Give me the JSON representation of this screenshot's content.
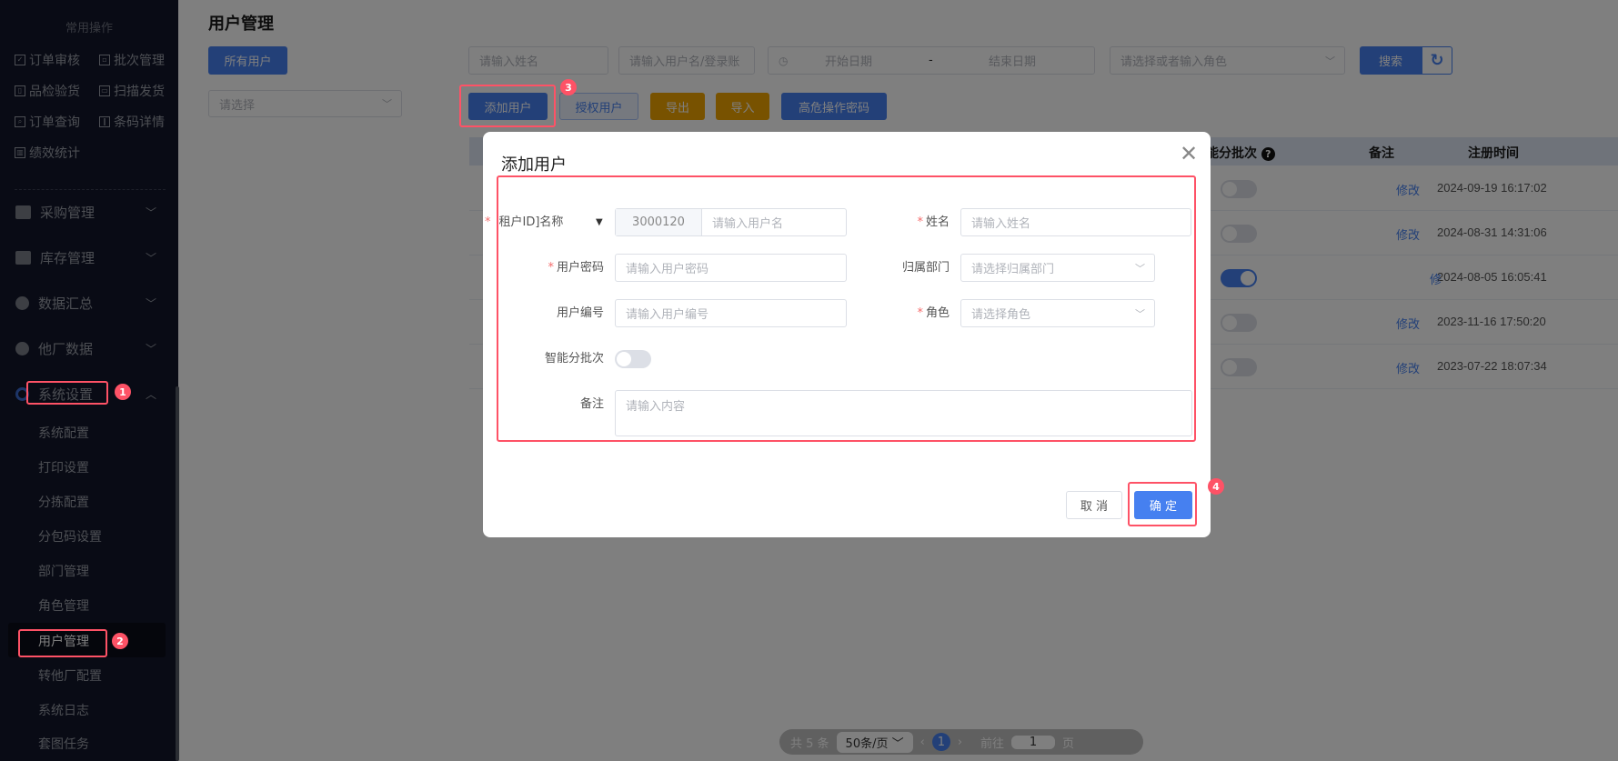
{
  "sidebar": {
    "quick_title": "常用操作",
    "quick_items": [
      {
        "label": "订单审核",
        "icon": "check-box-icon"
      },
      {
        "label": "批次管理",
        "icon": "batch-icon"
      },
      {
        "label": "品检验货",
        "icon": "inspect-icon"
      },
      {
        "label": "扫描发货",
        "icon": "scan-icon"
      },
      {
        "label": "订单查询",
        "icon": "search-order-icon"
      },
      {
        "label": "条码详情",
        "icon": "barcode-icon"
      },
      {
        "label": "绩效统计",
        "icon": "chart-icon"
      }
    ],
    "menus": [
      {
        "label": "采购管理",
        "icon": "store-icon",
        "chevron": "﹀"
      },
      {
        "label": "库存管理",
        "icon": "inventory-icon",
        "chevron": "﹀"
      },
      {
        "label": "数据汇总",
        "icon": "pie-chart-icon",
        "chevron": "﹀"
      },
      {
        "label": "他厂数据",
        "icon": "pie-chart-icon",
        "chevron": "﹀"
      },
      {
        "label": "系统设置",
        "icon": "settings-icon",
        "chevron": "︿"
      }
    ],
    "submenu": [
      "系统配置",
      "打印设置",
      "分拣配置",
      "分包码设置",
      "部门管理",
      "角色管理",
      "用户管理",
      "转他厂配置",
      "系统日志",
      "套图任务"
    ],
    "active": "用户管理"
  },
  "header": {
    "title": "用户管理"
  },
  "filters": {
    "all_users": "所有用户",
    "select_placeholder": "请选择",
    "name_placeholder": "请输入姓名",
    "username_placeholder": "请输入用户名/登录账",
    "start_date": "开始日期",
    "date_sep": "-",
    "end_date": "结束日期",
    "role_placeholder": "请选择或者输入角色",
    "search": "搜索",
    "refresh_icon": "refresh-icon"
  },
  "toolbar": {
    "add": "添加用户",
    "authorize": "授权用户",
    "export": "导出",
    "import": "导入",
    "danger_pwd": "高危操作密码"
  },
  "table": {
    "headers": {
      "smart_batch": "能分批次",
      "remark": "备注",
      "reg_time": "注册时间"
    },
    "rows": [
      {
        "smart_batch": false,
        "reg_time": "2024-09-19 16:17:02",
        "action": "修改"
      },
      {
        "smart_batch": false,
        "reg_time": "2024-08-31 14:31:06",
        "action": "修改"
      },
      {
        "smart_batch": true,
        "reg_time": "2024-08-05 16:05:41",
        "action": "修"
      },
      {
        "smart_batch": false,
        "reg_time": "2023-11-16 17:50:20",
        "action": "修改"
      },
      {
        "smart_batch": false,
        "reg_time": "2023-07-22 18:07:34",
        "action": "修改"
      }
    ]
  },
  "pagination": {
    "total": "共 5 条",
    "page_size": "50条/页",
    "current": "1",
    "goto": "前往",
    "goto_value": "1",
    "page_unit": "页"
  },
  "modal": {
    "title": "添加用户",
    "tenant_label": "租户ID]名称",
    "tenant_prefix": "3000120",
    "username_placeholder": "请输入用户名",
    "name_label": "姓名",
    "name_placeholder": "请输入姓名",
    "password_label": "用户密码",
    "password_placeholder": "请输入用户密码",
    "dept_label": "归属部门",
    "dept_placeholder": "请选择归属部门",
    "code_label": "用户编号",
    "code_placeholder": "请输入用户编号",
    "role_label": "角色",
    "role_placeholder": "请选择角色",
    "smart_label": "智能分批次",
    "smart_on": false,
    "remark_label": "备注",
    "remark_placeholder": "请输入内容",
    "cancel": "取 消",
    "confirm": "确 定",
    "required": "*"
  },
  "annotations": [
    "1",
    "2",
    "3",
    "4"
  ],
  "colors": {
    "primary": "#4680f0",
    "warning": "#f0a500",
    "annotation": "#fe5266",
    "sidebar": "#12172a"
  }
}
